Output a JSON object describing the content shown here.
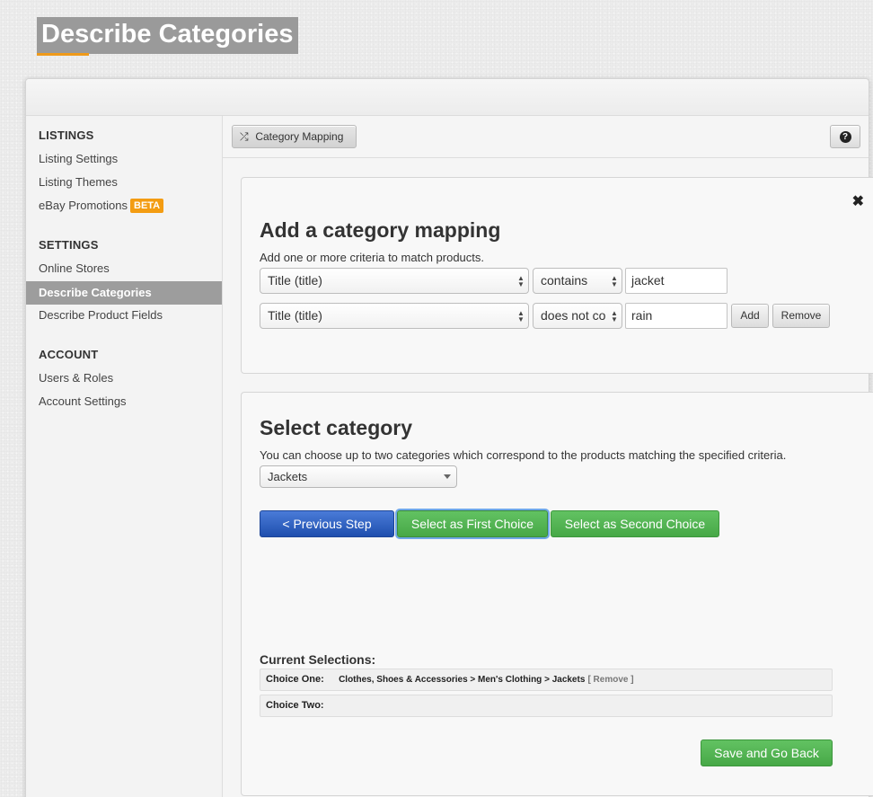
{
  "page": {
    "title": "Describe Categories"
  },
  "sidebar": {
    "sections": [
      {
        "heading": "LISTINGS",
        "items": [
          "Listing Settings",
          "Listing Themes",
          "eBay Promotions"
        ]
      },
      {
        "heading": "SETTINGS",
        "items": [
          "Online Stores",
          "Describe Categories",
          "Describe Product Fields"
        ]
      },
      {
        "heading": "ACCOUNT",
        "items": [
          "Users & Roles",
          "Account Settings"
        ]
      }
    ],
    "beta_badge": "BETA",
    "active_item": "Describe Categories"
  },
  "toolbar": {
    "category_mapping_label": "Category Mapping",
    "help_label": "?"
  },
  "mapping_panel": {
    "close_label": "✖",
    "title": "Add a category mapping",
    "description": "Add one or more criteria to match products.",
    "criteria": [
      {
        "field": "Title (title)",
        "operator": "contains",
        "value": "jacket"
      },
      {
        "field": "Title (title)",
        "operator": "does not co",
        "value": "rain"
      }
    ],
    "add_label": "Add",
    "remove_label": "Remove"
  },
  "category_panel": {
    "title": "Select category",
    "description": "You can choose up to two categories which correspond to the products matching the specified criteria.",
    "selected_category": "Jackets",
    "previous_step_label": "< Previous Step",
    "first_choice_label": "Select as First Choice",
    "second_choice_label": "Select as Second Choice",
    "current_selections_label": "Current Selections:",
    "choice_one_label": "Choice One:",
    "choice_one_value": "Clothes, Shoes & Accessories > Men's Clothing > Jackets",
    "choice_one_remove": "[ Remove ]",
    "choice_two_label": "Choice Two:",
    "choice_two_value": "",
    "save_label": "Save and Go Back"
  },
  "colors": {
    "accent_orange": "#ef9a1a",
    "primary_blue": "#2b5cc0",
    "success_green": "#52b352",
    "active_sidebar": "#9d9d9d"
  }
}
